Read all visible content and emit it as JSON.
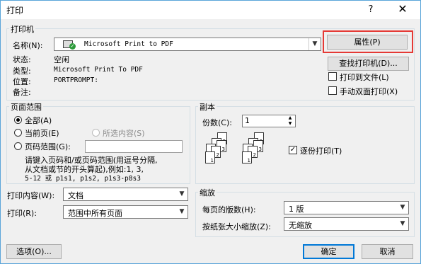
{
  "window": {
    "title": "打印",
    "help": "?",
    "close": "✕"
  },
  "printer": {
    "group_label": "打印机",
    "name_label": "名称(N):",
    "name_value": "Microsoft Print to PDF",
    "status_label": "状态:",
    "status_value": "空闲",
    "type_label": "类型:",
    "type_value": "Microsoft Print To PDF",
    "location_label": "位置:",
    "location_value": "PORTPROMPT:",
    "comment_label": "备注:",
    "properties_button": "属性(P)",
    "find_printer_button": "查找打印机(D)...",
    "print_to_file": "打印到文件(L)",
    "manual_duplex": "手动双面打印(X)"
  },
  "page_range": {
    "group_label": "页面范围",
    "all": "全部(A)",
    "current": "当前页(E)",
    "selection": "所选内容(S)",
    "pages": "页码范围(G):",
    "hint_line1": "请键入页码和/或页码范围(用逗号分隔,",
    "hint_line2": "从文档或节的开头算起),例如:1, 3,",
    "hint_line3": "5-12 或 p1s1, p1s2, p1s3-p8s3"
  },
  "copies": {
    "group_label": "副本",
    "count_label": "份数(C):",
    "count_value": "1",
    "collate": "逐份打印(T)",
    "page_numbers": [
      "1",
      "2",
      "3"
    ]
  },
  "print_what": {
    "label": "打印内容(W):",
    "value": "文档"
  },
  "print_mode": {
    "label": "打印(R):",
    "value": "范围中所有页面"
  },
  "zoom": {
    "group_label": "缩放",
    "pages_per_sheet_label": "每页的版数(H):",
    "pages_per_sheet_value": "1 版",
    "scale_label": "按纸张大小缩放(Z):",
    "scale_value": "无缩放"
  },
  "footer": {
    "options": "选项(O)...",
    "ok": "确定",
    "cancel": "取消"
  },
  "colors": {
    "highlight": "#e53935",
    "focus": "#0078d7"
  }
}
